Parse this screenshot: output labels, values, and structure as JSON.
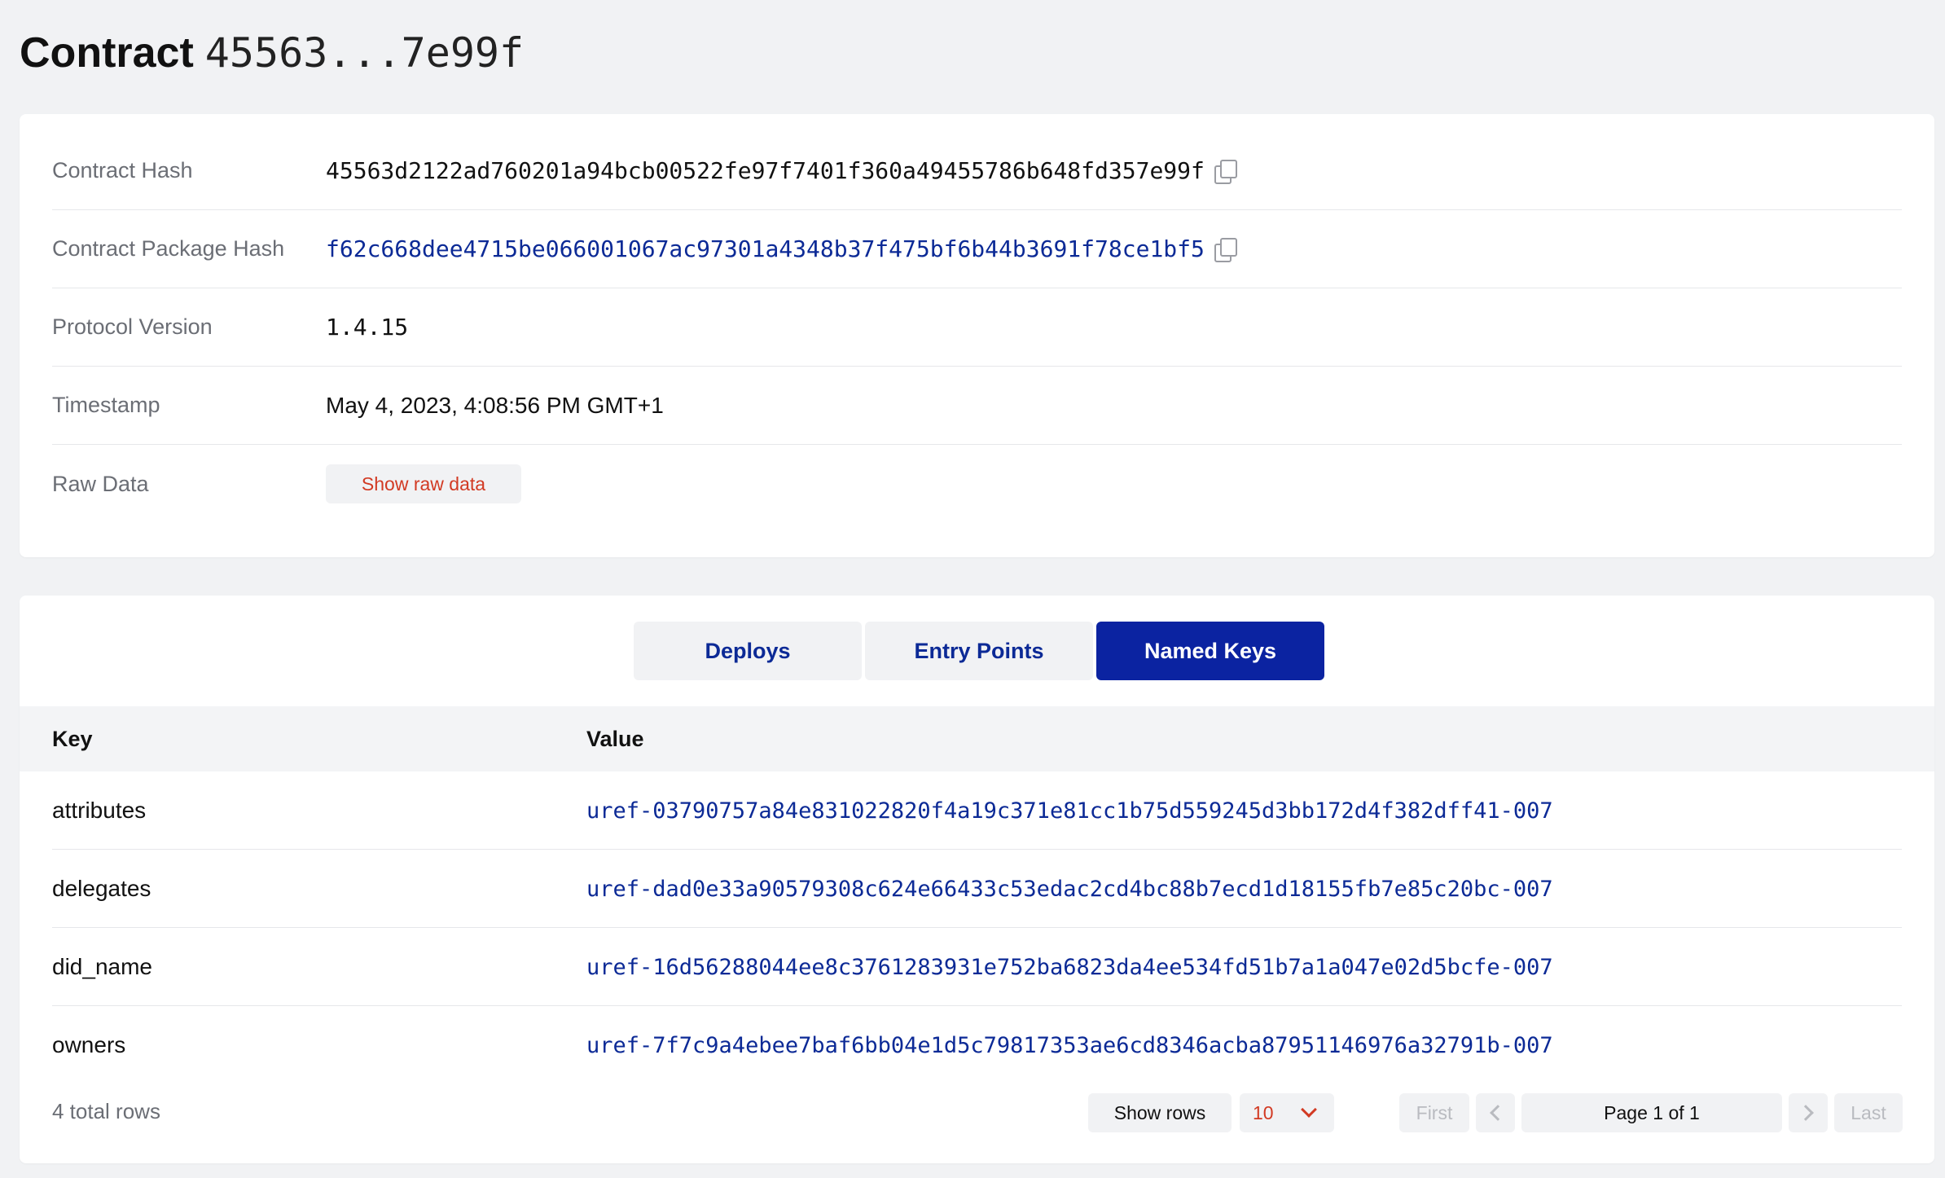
{
  "header": {
    "title_label": "Contract",
    "title_hash": "45563...7e99f"
  },
  "details": {
    "contract_hash_label": "Contract Hash",
    "contract_hash": "45563d2122ad760201a94bcb00522fe97f7401f360a49455786b648fd357e99f",
    "package_hash_label": "Contract Package Hash",
    "package_hash": "f62c668dee4715be066001067ac97301a4348b37f475bf6b44b3691f78ce1bf5",
    "protocol_label": "Protocol Version",
    "protocol_version": "1.4.15",
    "timestamp_label": "Timestamp",
    "timestamp": "May 4, 2023, 4:08:56 PM GMT+1",
    "raw_label": "Raw Data",
    "raw_button": "Show raw data"
  },
  "tabs": {
    "items": [
      "Deploys",
      "Entry Points",
      "Named Keys"
    ],
    "active": "Named Keys"
  },
  "table": {
    "headers": {
      "key": "Key",
      "value": "Value"
    },
    "rows": [
      {
        "key": "attributes",
        "value": "uref-03790757a84e831022820f4a19c371e81cc1b75d559245d3bb172d4f382dff41-007"
      },
      {
        "key": "delegates",
        "value": "uref-dad0e33a90579308c624e66433c53edac2cd4bc88b7ecd1d18155fb7e85c20bc-007"
      },
      {
        "key": "did_name",
        "value": "uref-16d56288044ee8c3761283931e752ba6823da4ee534fd51b7a1a047e02d5bcfe-007"
      },
      {
        "key": "owners",
        "value": "uref-7f7c9a4ebee7baf6bb04e1d5c79817353ae6cd8346acba87951146976a32791b-007"
      }
    ]
  },
  "pagination": {
    "total_rows": "4 total rows",
    "show_rows_label": "Show rows",
    "rows_value": "10",
    "first": "First",
    "page_indicator": "Page 1 of 1",
    "last": "Last"
  },
  "colors": {
    "accent": "#0b23a1",
    "link": "#0c2a96",
    "danger": "#d23a23",
    "background": "#f1f2f4"
  }
}
